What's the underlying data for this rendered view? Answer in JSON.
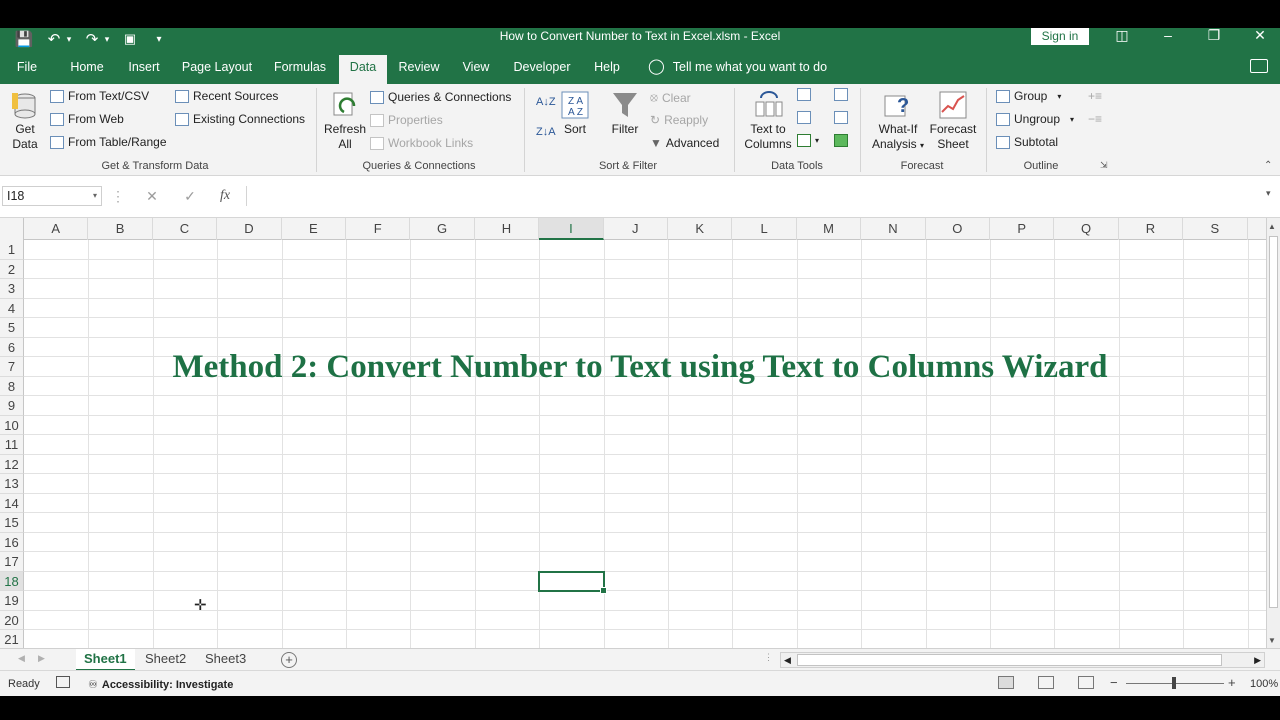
{
  "window": {
    "title": "How to Convert Number to Text in Excel.xlsm  -  Excel",
    "sign_in": "Sign in"
  },
  "tabs": [
    "File",
    "Home",
    "Insert",
    "Page Layout",
    "Formulas",
    "Data",
    "Review",
    "View",
    "Developer",
    "Help"
  ],
  "active_tab": "Data",
  "tell_me": "Tell me what you want to do",
  "ribbon": {
    "get_transform": {
      "get_data": "Get",
      "get_data2": "Data",
      "from_text_csv": "From Text/CSV",
      "from_web": "From Web",
      "from_table_range": "From Table/Range",
      "recent_sources": "Recent Sources",
      "existing_connections": "Existing Connections",
      "label": "Get & Transform Data"
    },
    "queries": {
      "refresh": "Refresh",
      "refresh2": "All",
      "queries_connections": "Queries & Connections",
      "properties": "Properties",
      "workbook_links": "Workbook Links",
      "label": "Queries & Connections"
    },
    "sort_filter": {
      "sort": "Sort",
      "filter": "Filter",
      "clear": "Clear",
      "reapply": "Reapply",
      "advanced": "Advanced",
      "label": "Sort & Filter"
    },
    "data_tools": {
      "text_to_columns": "Text to",
      "text_to_columns2": "Columns",
      "label": "Data Tools"
    },
    "forecast": {
      "what_if": "What-If",
      "what_if2": "Analysis",
      "forecast_sheet": "Forecast",
      "forecast_sheet2": "Sheet",
      "label": "Forecast"
    },
    "outline": {
      "group": "Group",
      "ungroup": "Ungroup",
      "subtotal": "Subtotal",
      "label": "Outline"
    }
  },
  "formula_bar": {
    "name_box": "I18",
    "fx": "fx",
    "cancel": "✕",
    "enter": "✓",
    "value": ""
  },
  "grid": {
    "columns": [
      "A",
      "B",
      "C",
      "D",
      "E",
      "F",
      "G",
      "H",
      "I",
      "J",
      "K",
      "L",
      "M",
      "N",
      "O",
      "P",
      "Q",
      "R",
      "S"
    ],
    "rows": [
      "1",
      "2",
      "3",
      "4",
      "5",
      "6",
      "7",
      "8",
      "9",
      "10",
      "11",
      "12",
      "13",
      "14",
      "15",
      "16",
      "17",
      "18",
      "19",
      "20",
      "21"
    ],
    "active_column": "I",
    "active_row": "18",
    "headline": "Method 2: Convert Number to Text using Text to Columns Wizard"
  },
  "sheets": [
    "Sheet1",
    "Sheet2",
    "Sheet3"
  ],
  "active_sheet": "Sheet1",
  "status": {
    "ready": "Ready",
    "accessibility": "Accessibility: Investigate",
    "zoom": "100%",
    "zoom_minus": "−",
    "zoom_plus": "+"
  },
  "colors": {
    "accent": "#217346",
    "headline": "#1e7145"
  }
}
